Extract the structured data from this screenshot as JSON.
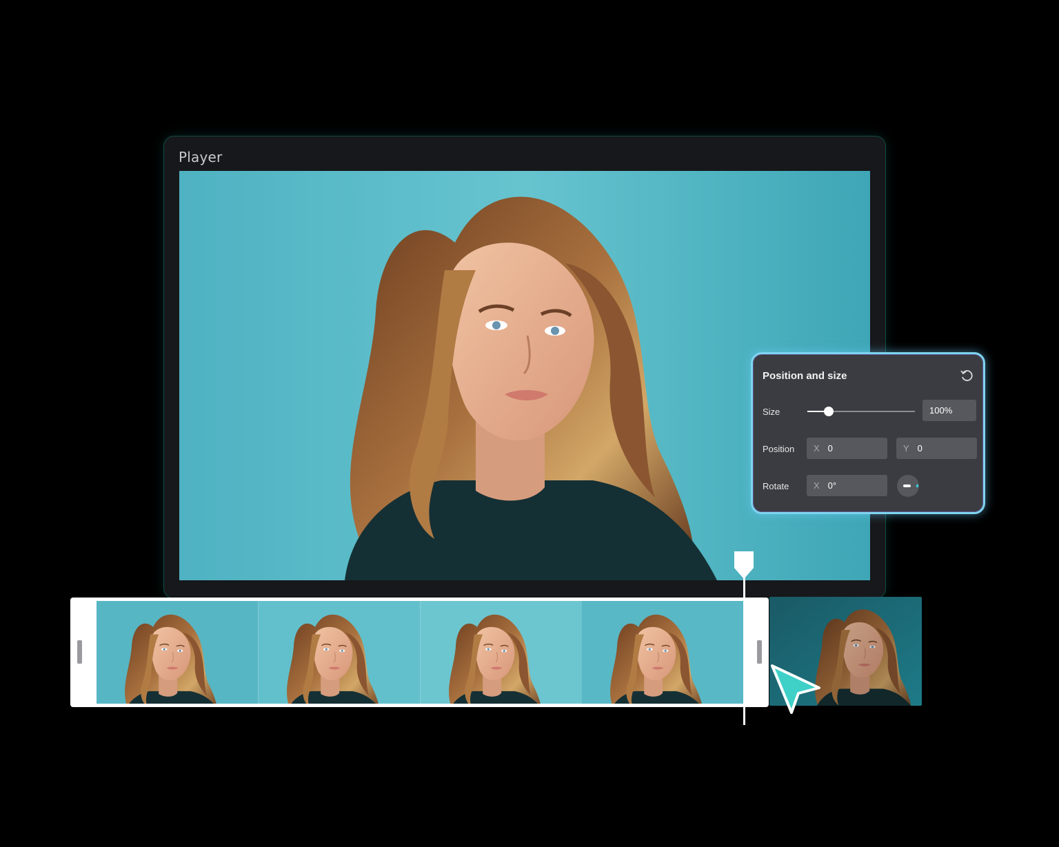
{
  "player": {
    "title": "Player"
  },
  "panel": {
    "title": "Position and size",
    "size_label": "Size",
    "size_value": "100%",
    "size_slider_fraction": 0.2,
    "position_label": "Position",
    "position_x_axis": "X",
    "position_x_value": "0",
    "position_y_axis": "Y",
    "position_y_value": "0",
    "rotate_label": "Rotate",
    "rotate_x_axis": "X",
    "rotate_x_value": "0°",
    "reset_icon": "reset-icon",
    "rotate_dial_icon": "rotate-dial-icon"
  },
  "timeline": {
    "frame_count": 4,
    "playhead_icon": "playhead-marker-icon"
  },
  "colors": {
    "background": "#000000",
    "player_bg": "#17181b",
    "backdrop_teal": "#5ab8c6",
    "panel_bg": "#3b3c41",
    "panel_glow": "#7fd4ef",
    "cursor_teal": "#3fd0c8",
    "field_bg": "#57585d"
  },
  "cursor": {
    "icon": "cursor-arrow-icon"
  }
}
